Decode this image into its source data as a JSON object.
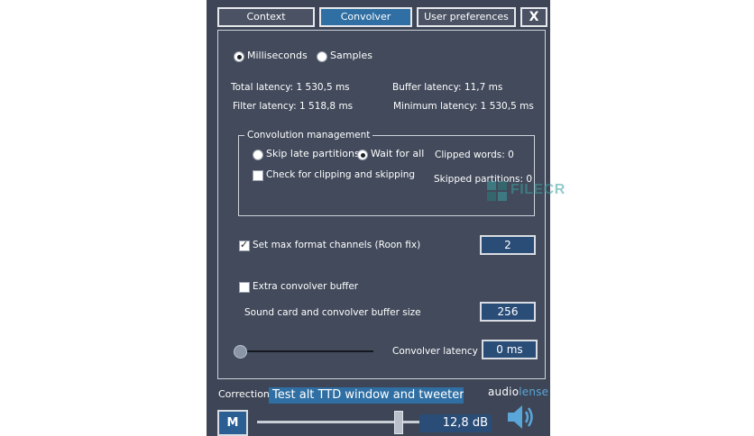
{
  "tabs": {
    "context": "Context",
    "convolver": "Convolver",
    "user_preferences": "User preferences",
    "close": "X"
  },
  "units": {
    "milliseconds": "Milliseconds",
    "samples": "Samples",
    "selected": "Milliseconds"
  },
  "latency": {
    "total": "Total latency: 1 530,5 ms",
    "buffer": "Buffer latency: 11,7 ms",
    "filter": "Filter latency: 1 518,8 ms",
    "minimum": "Minimum latency: 1 530,5 ms"
  },
  "convolution_management": {
    "title": "Convolution management",
    "skip_late": "Skip late partitions",
    "wait_for_all": "Wait for all",
    "selected": "Wait for all",
    "check_clipping": "Check for clipping and skipping",
    "check_clipping_checked": false,
    "clipped_words": "Clipped words: 0",
    "skipped_partitions": "Skipped partitions: 0"
  },
  "max_format_channels": {
    "label": "Set max format channels (Roon fix)",
    "checked": true,
    "value": "2"
  },
  "extra_buffer": {
    "label": "Extra convolver buffer",
    "checked": false
  },
  "buffer_size": {
    "label": "Sound card and convolver buffer size",
    "value": "256"
  },
  "convolver_latency": {
    "label": "Convolver latency",
    "value": "0 ms",
    "slider_fraction": 0
  },
  "correction": {
    "label": "Correction:",
    "value": "Test alt TTD window and tweeter ac"
  },
  "logo": {
    "part1": "audio",
    "part2": "lense"
  },
  "bottom": {
    "mute_label": "M",
    "volume_value": "12,8 dB",
    "volume_fraction": 0.88
  },
  "watermark": {
    "text": "FILECR"
  },
  "colors": {
    "background": "#3d4556",
    "panel": "#424a5b",
    "accent_blue": "#2f6fa3",
    "value_box": "#2a4d78",
    "logo_blue": "#5aa6d8"
  }
}
